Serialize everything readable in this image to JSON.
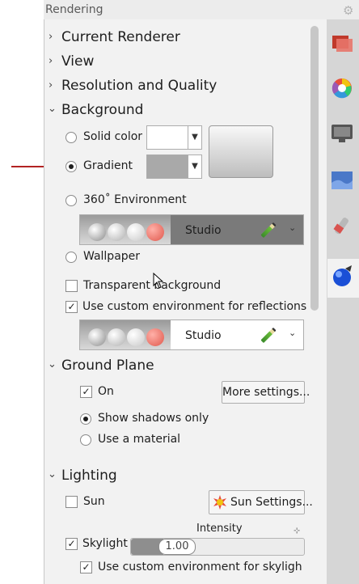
{
  "panel": {
    "title": "Rendering"
  },
  "sections": {
    "current_renderer": "Current Renderer",
    "view": "View",
    "resolution": "Resolution and Quality",
    "background": "Background",
    "ground_plane": "Ground Plane",
    "lighting": "Lighting"
  },
  "background": {
    "solid_color": "Solid color",
    "gradient": "Gradient",
    "env360": "360˚ Environment",
    "env360_name": "Studio",
    "wallpaper": "Wallpaper",
    "transparent": "Transparent background",
    "custom_env_reflections": "Use custom environment for reflections",
    "reflection_env_name": "Studio",
    "selected": "Gradient",
    "transparent_checked": false,
    "custom_env_reflections_checked": true,
    "colors": {
      "solid": "#ffffff",
      "gradient": "#a9a9a9"
    }
  },
  "ground_plane": {
    "on": "On",
    "on_checked": true,
    "more_settings": "More settings...",
    "show_shadows": "Show shadows only",
    "use_material": "Use a material",
    "selected": "Show shadows only"
  },
  "lighting": {
    "sun": "Sun",
    "sun_checked": false,
    "sun_settings": "Sun Settings...",
    "skylight": "Skylight",
    "skylight_checked": true,
    "intensity_label": "Intensity",
    "intensity_value": "1.00",
    "custom_env_skylight": "Use custom environment for skyligh",
    "custom_env_skylight_checked": true
  },
  "side_tabs": [
    "object-properties-icon",
    "materials-icon",
    "display-icon",
    "environment-icon",
    "lights-icon",
    "rendering-icon"
  ],
  "accent": {
    "arrow": "#b22222"
  }
}
